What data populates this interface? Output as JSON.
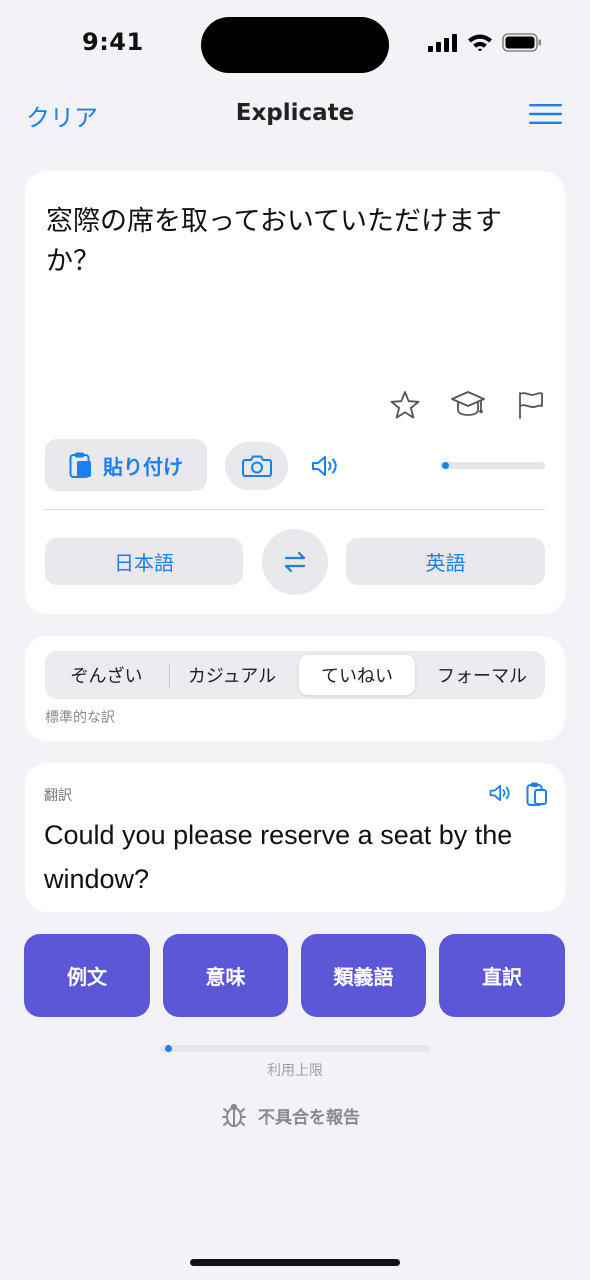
{
  "status_bar": {
    "time": "9:41"
  },
  "nav": {
    "left_label": "クリア",
    "title": "Explicate"
  },
  "input": {
    "text": "窓際の席を取っておいていただけますか？",
    "paste_label": "貼り付け",
    "progress": 0.02
  },
  "languages": {
    "source": "日本語",
    "target": "英語"
  },
  "tone": {
    "options": [
      "ぞんざい",
      "カジュアル",
      "ていねい",
      "フォーマル"
    ],
    "selected": "ていねい",
    "description": "標準的な訳"
  },
  "translation": {
    "label": "翻訳",
    "text": "Could you please reserve a seat by the window?"
  },
  "actions": [
    "例文",
    "意味",
    "類義語",
    "直訳"
  ],
  "usage": {
    "label": "利用上限",
    "progress": 0.02
  },
  "report": {
    "label": "不具合を報告"
  },
  "colors": {
    "accent": "#1a7ff0",
    "action": "#5b57d6",
    "background": "#f2f2f7"
  },
  "icons": [
    "signal-icon",
    "wifi-icon",
    "battery-icon",
    "menu-icon",
    "star-icon",
    "graduation-cap-icon",
    "flag-icon",
    "clipboard-icon",
    "camera-icon",
    "speaker-icon",
    "swap-icon",
    "copy-icon",
    "bug-icon"
  ]
}
